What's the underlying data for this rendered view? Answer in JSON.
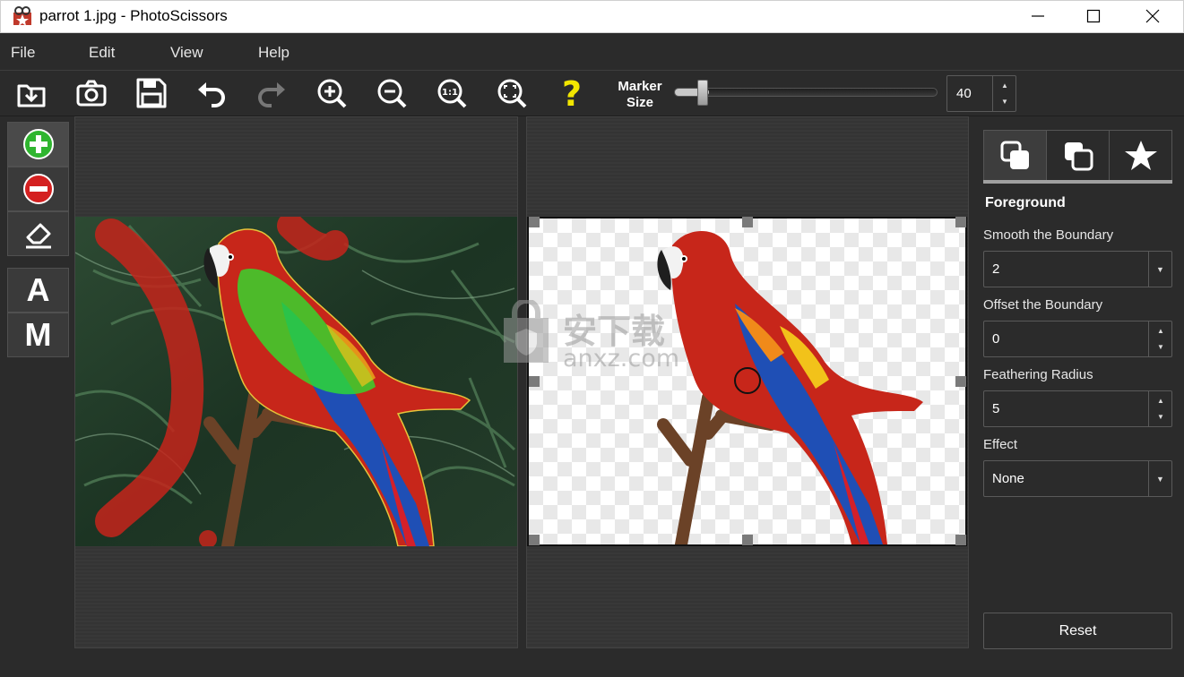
{
  "window": {
    "title": "parrot 1.jpg - PhotoScissors",
    "minimize_icon": "minimize-icon",
    "maximize_icon": "maximize-icon",
    "close_icon": "close-icon"
  },
  "menu": {
    "items": [
      "File",
      "Edit",
      "View",
      "Help"
    ]
  },
  "toolbar": {
    "buttons": [
      "open-icon",
      "camera-icon",
      "save-icon",
      "undo-icon",
      "redo-icon",
      "zoom-in-icon",
      "zoom-out-icon",
      "zoom-actual-icon",
      "zoom-fit-icon",
      "help-icon"
    ],
    "marker_label_line1": "Marker",
    "marker_label_line2": "Size",
    "marker_value": "40",
    "marker_level": 0.13
  },
  "tools": {
    "add_icon": "plus-circle-icon",
    "remove_icon": "minus-circle-icon",
    "eraser_icon": "eraser-icon",
    "auto_label": "A",
    "manual_label": "M"
  },
  "panel": {
    "tabs": [
      "foreground-tab-icon",
      "background-tab-icon",
      "star-icon"
    ],
    "title": "Foreground",
    "smooth_label": "Smooth the Boundary",
    "smooth_value": "2",
    "offset_label": "Offset the Boundary",
    "offset_value": "0",
    "feather_label": "Feathering Radius",
    "feather_value": "5",
    "effect_label": "Effect",
    "effect_value": "None",
    "reset_label": "Reset"
  },
  "watermark": {
    "cn": "安下载",
    "en": "anxz.com"
  },
  "colors": {
    "foreground_marker": "#2ee02e",
    "background_marker": "#e02020",
    "help": "#f2e600"
  }
}
